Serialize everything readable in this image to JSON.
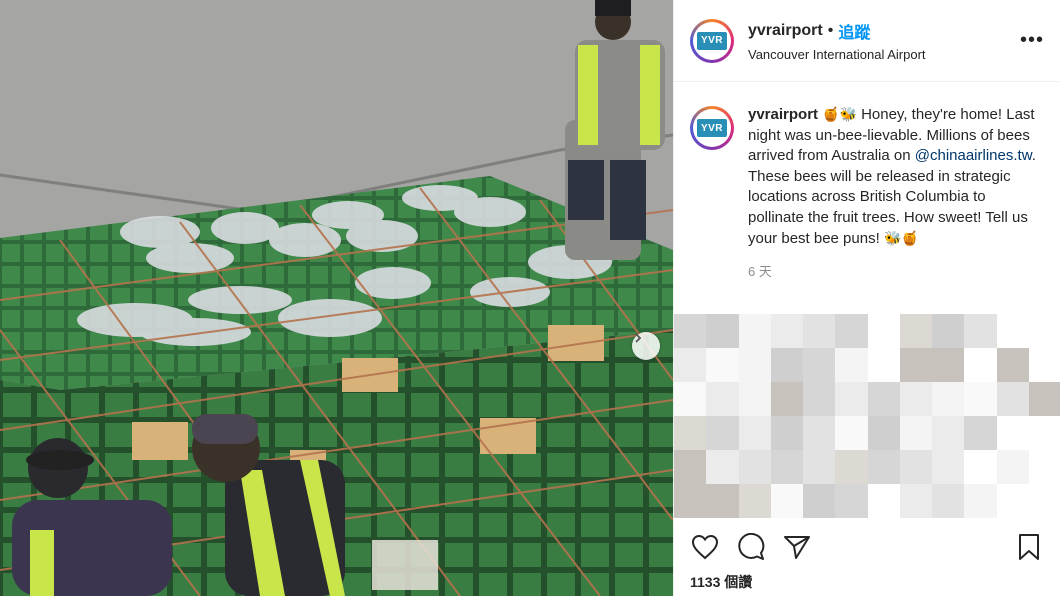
{
  "post": {
    "username": "yvrairport",
    "avatar_text": "YVR",
    "follow_label": "追蹤",
    "separator": "•",
    "location": "Vancouver International Airport",
    "more_label": "•••"
  },
  "caption": {
    "username": "yvrairport",
    "emoji_lead": "🍯🐝",
    "text_part1": " Honey, they're home! Last night was un-bee-lievable. Millions of bees arrived from Australia on ",
    "mention": "@chinaairlines.tw",
    "text_part2": ". These bees will be released in strategic locations across British Columbia to pollinate the fruit trees. How sweet! Tell us your best bee puns! ",
    "emoji_tail": "🐝🍯",
    "time": "6 天"
  },
  "stats": {
    "views": "1133 個讚"
  },
  "icons": {
    "like": "heart-icon",
    "comment": "comment-icon",
    "share": "paper-plane-icon",
    "save": "bookmark-icon",
    "next": "chevron-right-icon"
  },
  "colors": {
    "link_blue": "#0095f6",
    "mention": "#00376b",
    "muted": "#8e8e8e"
  }
}
